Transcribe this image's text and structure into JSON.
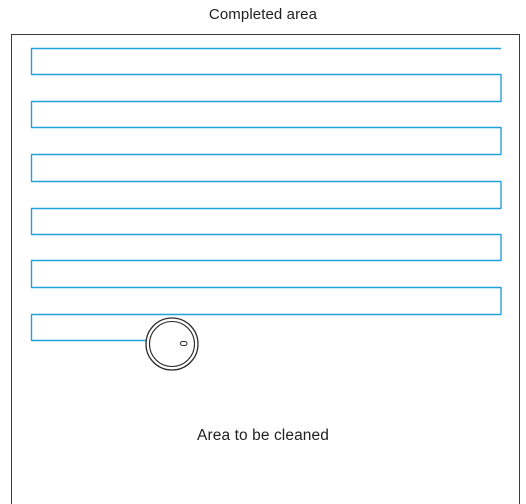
{
  "labels": {
    "completed_area": "Completed area",
    "area_to_be_cleaned": "Area to be cleaned"
  },
  "colors": {
    "path": "#1fa3df",
    "border": "#3a3a3a",
    "robot_stroke": "#2b2b2b",
    "text": "#1f1f1f"
  },
  "icons": {
    "robot": "robot-vacuum-icon"
  }
}
